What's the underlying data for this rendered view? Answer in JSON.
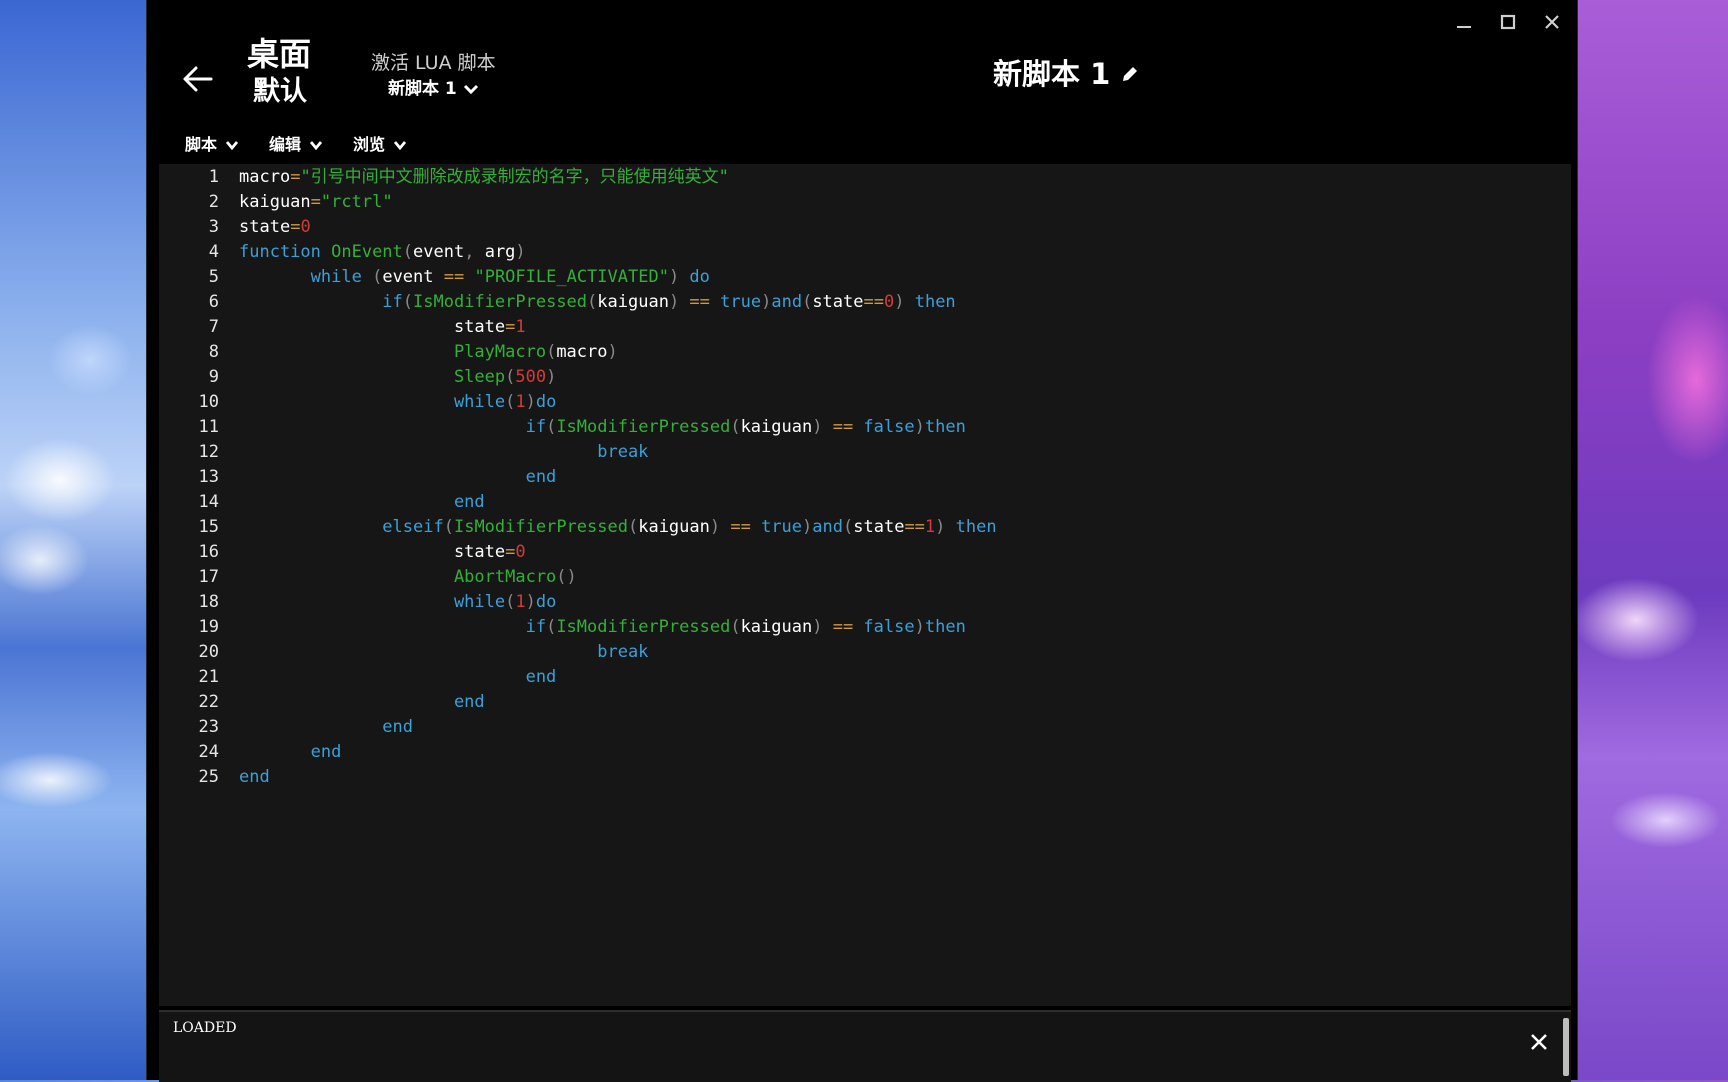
{
  "window": {
    "title_main": "桌面",
    "title_sub": "默认",
    "activate_label": "激活 LUA 脚本",
    "activate_selected": "新脚本 1",
    "script_name": "新脚本 1"
  },
  "menu": {
    "script": "脚本",
    "edit": "编辑",
    "browse": "浏览"
  },
  "editor": {
    "line_numbers": [
      "1",
      "2",
      "3",
      "4",
      "5",
      "6",
      "7",
      "8",
      "9",
      "10",
      "11",
      "12",
      "13",
      "14",
      "15",
      "16",
      "17",
      "18",
      "19",
      "20",
      "21",
      "22",
      "23",
      "24",
      "25"
    ],
    "lines": [
      [
        [
          "macro",
          "id"
        ],
        [
          "=",
          "op"
        ],
        [
          "\"引号中间中文删除改成录制宏的名字，只能使用纯英文\"",
          "str"
        ]
      ],
      [
        [
          "kaiguan",
          "id"
        ],
        [
          "=",
          "op"
        ],
        [
          "\"rctrl\"",
          "str"
        ]
      ],
      [
        [
          "state",
          "id"
        ],
        [
          "=",
          "op"
        ],
        [
          "0",
          "num"
        ]
      ],
      [
        [
          "function ",
          "kw"
        ],
        [
          "OnEvent",
          "fn"
        ],
        [
          "(",
          "p"
        ],
        [
          "event",
          "id"
        ],
        [
          ", ",
          "p"
        ],
        [
          "arg",
          "id"
        ],
        [
          ")",
          "p"
        ]
      ],
      [
        [
          "       ",
          ""
        ],
        [
          "while ",
          "kw"
        ],
        [
          "(",
          "p"
        ],
        [
          "event ",
          "id"
        ],
        [
          "== ",
          "op"
        ],
        [
          "\"PROFILE_ACTIVATED\"",
          "str"
        ],
        [
          ") ",
          "p"
        ],
        [
          "do",
          "kw"
        ]
      ],
      [
        [
          "              ",
          ""
        ],
        [
          "if",
          "kw"
        ],
        [
          "(",
          "p"
        ],
        [
          "IsModifierPressed",
          "fn"
        ],
        [
          "(",
          "p"
        ],
        [
          "kaiguan",
          "id"
        ],
        [
          ") ",
          "p"
        ],
        [
          "== ",
          "op"
        ],
        [
          "true",
          "kw"
        ],
        [
          ")",
          "p"
        ],
        [
          "and",
          "kw"
        ],
        [
          "(",
          "p"
        ],
        [
          "state",
          "id"
        ],
        [
          "==",
          "op"
        ],
        [
          "0",
          "num"
        ],
        [
          ") ",
          "p"
        ],
        [
          "then",
          "kw"
        ]
      ],
      [
        [
          "                     ",
          ""
        ],
        [
          "state",
          "id"
        ],
        [
          "=",
          "op"
        ],
        [
          "1",
          "num"
        ]
      ],
      [
        [
          "                     ",
          ""
        ],
        [
          "PlayMacro",
          "fn"
        ],
        [
          "(",
          "p"
        ],
        [
          "macro",
          "id"
        ],
        [
          ")",
          "p"
        ]
      ],
      [
        [
          "                     ",
          ""
        ],
        [
          "Sleep",
          "fn"
        ],
        [
          "(",
          "p"
        ],
        [
          "500",
          "num"
        ],
        [
          ")",
          "p"
        ]
      ],
      [
        [
          "                     ",
          ""
        ],
        [
          "while",
          "kw"
        ],
        [
          "(",
          "p"
        ],
        [
          "1",
          "num"
        ],
        [
          ")",
          "p"
        ],
        [
          "do",
          "kw"
        ]
      ],
      [
        [
          "                            ",
          ""
        ],
        [
          "if",
          "kw"
        ],
        [
          "(",
          "p"
        ],
        [
          "IsModifierPressed",
          "fn"
        ],
        [
          "(",
          "p"
        ],
        [
          "kaiguan",
          "id"
        ],
        [
          ") ",
          "p"
        ],
        [
          "== ",
          "op"
        ],
        [
          "false",
          "kw"
        ],
        [
          ")",
          "p"
        ],
        [
          "then",
          "kw"
        ]
      ],
      [
        [
          "                                   ",
          ""
        ],
        [
          "break",
          "kw"
        ]
      ],
      [
        [
          "                            ",
          ""
        ],
        [
          "end",
          "kw"
        ]
      ],
      [
        [
          "                     ",
          ""
        ],
        [
          "end",
          "kw"
        ]
      ],
      [
        [
          "              ",
          ""
        ],
        [
          "elseif",
          "kw"
        ],
        [
          "(",
          "p"
        ],
        [
          "IsModifierPressed",
          "fn"
        ],
        [
          "(",
          "p"
        ],
        [
          "kaiguan",
          "id"
        ],
        [
          ") ",
          "p"
        ],
        [
          "== ",
          "op"
        ],
        [
          "true",
          "kw"
        ],
        [
          ")",
          "p"
        ],
        [
          "and",
          "kw"
        ],
        [
          "(",
          "p"
        ],
        [
          "state",
          "id"
        ],
        [
          "==",
          "op"
        ],
        [
          "1",
          "num"
        ],
        [
          ") ",
          "p"
        ],
        [
          "then",
          "kw"
        ]
      ],
      [
        [
          "                     ",
          ""
        ],
        [
          "state",
          "id"
        ],
        [
          "=",
          "op"
        ],
        [
          "0",
          "num"
        ]
      ],
      [
        [
          "                     ",
          ""
        ],
        [
          "AbortMacro",
          "fn"
        ],
        [
          "()",
          "p"
        ]
      ],
      [
        [
          "                     ",
          ""
        ],
        [
          "while",
          "kw"
        ],
        [
          "(",
          "p"
        ],
        [
          "1",
          "num"
        ],
        [
          ")",
          "p"
        ],
        [
          "do",
          "kw"
        ]
      ],
      [
        [
          "                            ",
          ""
        ],
        [
          "if",
          "kw"
        ],
        [
          "(",
          "p"
        ],
        [
          "IsModifierPressed",
          "fn"
        ],
        [
          "(",
          "p"
        ],
        [
          "kaiguan",
          "id"
        ],
        [
          ") ",
          "p"
        ],
        [
          "== ",
          "op"
        ],
        [
          "false",
          "kw"
        ],
        [
          ")",
          "p"
        ],
        [
          "then",
          "kw"
        ]
      ],
      [
        [
          "                                   ",
          ""
        ],
        [
          "break",
          "kw"
        ]
      ],
      [
        [
          "                            ",
          ""
        ],
        [
          "end",
          "kw"
        ]
      ],
      [
        [
          "                     ",
          ""
        ],
        [
          "end",
          "kw"
        ]
      ],
      [
        [
          "              ",
          ""
        ],
        [
          "end",
          "kw"
        ]
      ],
      [
        [
          "       ",
          ""
        ],
        [
          "end",
          "kw"
        ]
      ],
      [
        [
          "end",
          "kw"
        ]
      ]
    ]
  },
  "status": {
    "text": "LOADED"
  },
  "colors": {
    "keyword": "#3aa0d8",
    "function": "#33b038",
    "string": "#33b038",
    "number": "#d33a3a",
    "operator": "#d39a3a",
    "identifier": "#ffffff"
  },
  "icons": {
    "back": "arrow-left-icon",
    "minimize": "minimize-icon",
    "maximize": "maximize-icon",
    "close": "close-icon",
    "edit": "pencil-icon",
    "dropdown": "chevron-down-icon"
  }
}
